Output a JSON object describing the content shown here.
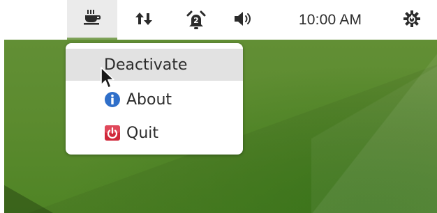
{
  "topbar": {
    "clock": "10:00 AM",
    "indicators": {
      "caffeine": "coffee-cup-icon",
      "network": "network-arrows-icon",
      "alarm": "alarm-clock-icon",
      "alarm_badge": "2",
      "sound": "speaker-icon",
      "system": "power-gear-icon"
    }
  },
  "menu": {
    "items": [
      {
        "label": "Deactivate",
        "icon": "",
        "state": "hover"
      },
      {
        "label": "About",
        "icon": "info-icon"
      },
      {
        "label": "Quit",
        "icon": "power-icon"
      }
    ]
  },
  "colors": {
    "desktop": "#5b8a2e",
    "active_indicator": "#7fa35a",
    "info_blue": "#2f6fc9",
    "quit_red": "#d0283a",
    "menu_hover": "#e2e2e2"
  }
}
